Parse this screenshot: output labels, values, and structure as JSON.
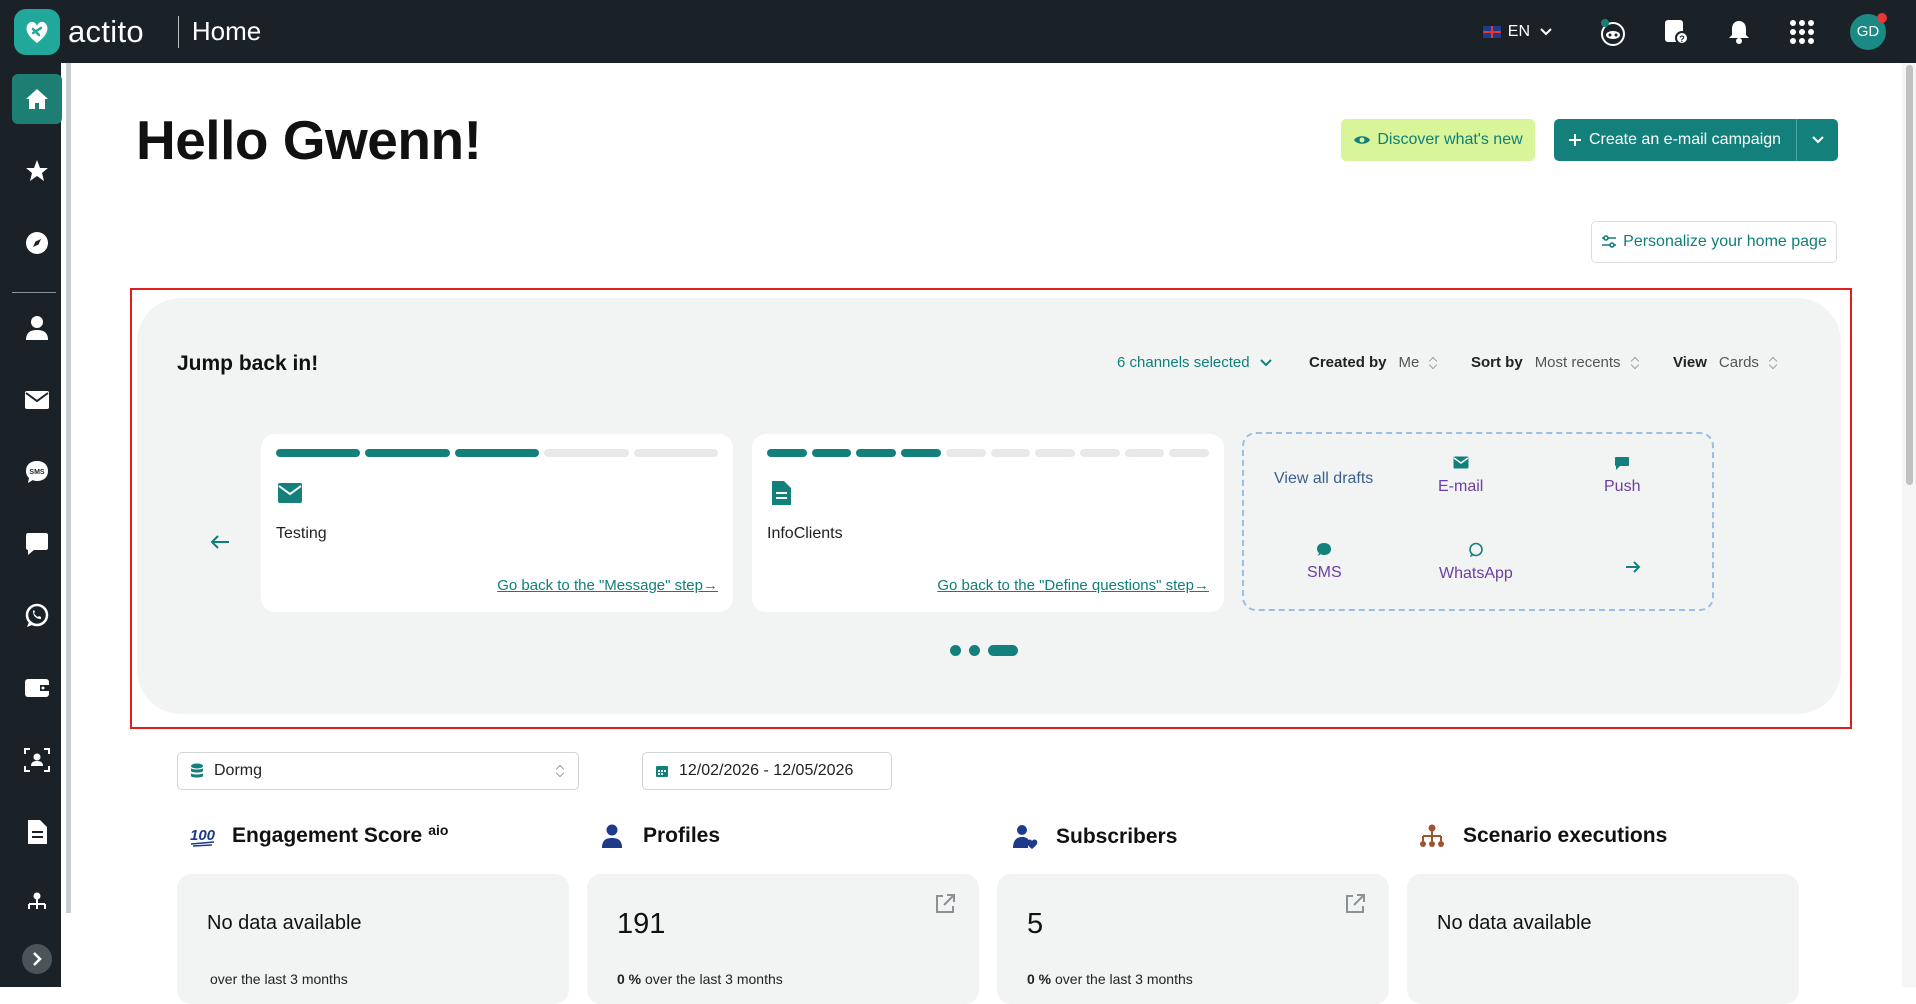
{
  "topbar": {
    "brand_name": "actito",
    "page_title": "Home",
    "language": "EN",
    "avatar_initials": "GD"
  },
  "sidebar": {
    "items": [
      "home",
      "favorites",
      "explore",
      "profiles",
      "email",
      "sms",
      "push",
      "whatsapp",
      "wallet",
      "segments",
      "documents",
      "scenarios"
    ]
  },
  "header": {
    "greeting": "Hello Gwenn!",
    "discover_label": "Discover what's new",
    "create_label": "Create an e-mail campaign",
    "personalize_label": "Personalize your home page"
  },
  "jump": {
    "title": "Jump back in!",
    "channels": "6 channels selected",
    "created_by_label": "Created by",
    "created_by_value": "Me",
    "sort_by_label": "Sort by",
    "sort_by_value": "Most recents",
    "view_label": "View",
    "view_value": "Cards",
    "cards": [
      {
        "name": "Testing",
        "link": "Go back to the \"Message\" step→",
        "steps_done": 3,
        "steps_total": 5,
        "icon": "envelope-icon"
      },
      {
        "name": "InfoClients",
        "link": "Go back to the \"Define questions\" step→",
        "steps_done": 4,
        "steps_total": 10,
        "icon": "document-icon"
      }
    ],
    "drafts": {
      "view_all": "View all drafts",
      "email": "E-mail",
      "push": "Push",
      "sms": "SMS",
      "whatsapp": "WhatsApp"
    },
    "pager": {
      "pages": 3,
      "current": 3
    }
  },
  "filters": {
    "database": "Dormg",
    "date_range": "12/02/2026 - 12/05/2026"
  },
  "stats": {
    "engagement": {
      "title": "Engagement Score",
      "badge": "aio",
      "value": "No data available",
      "sub": "over the last 3 months"
    },
    "profiles": {
      "title": "Profiles",
      "value": "191",
      "pct": "0 %",
      "sub": " over the last 3 months"
    },
    "subscribers": {
      "title": "Subscribers",
      "value": "5",
      "pct": "0 %",
      "sub": " over the last 3 months"
    },
    "scenarios": {
      "title": "Scenario executions",
      "value": "No data available"
    }
  },
  "colors": {
    "teal": "#14807c",
    "dark": "#1a2228",
    "lime": "#d8f59a",
    "highlight": "#e01e1e"
  }
}
